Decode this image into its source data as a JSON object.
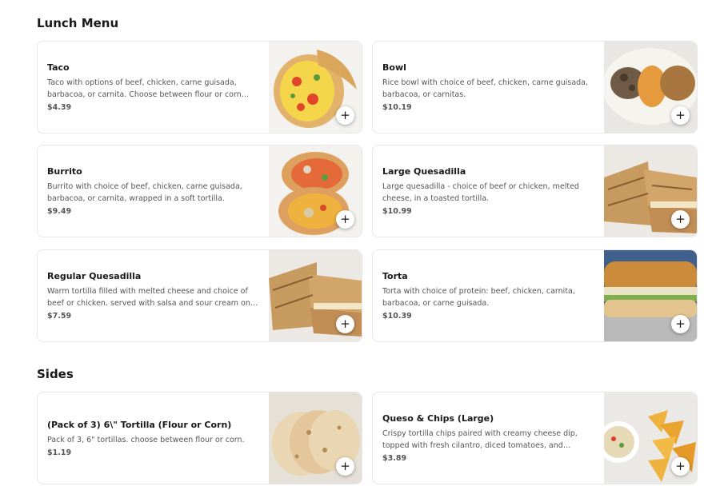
{
  "sections": [
    {
      "title": "Lunch Menu",
      "items": [
        {
          "name": "Taco",
          "description": "Taco with options of beef, chicken, carne guisada, barbacoa, or carnita. Choose between flour or corn tortilla.",
          "price": "$4.39",
          "image": "taco-image"
        },
        {
          "name": "Bowl",
          "description": "Rice bowl with choice of beef, chicken, carne guisada, barbacoa, or carnitas.",
          "price": "$10.19",
          "image": "bowl-image"
        },
        {
          "name": "Burrito",
          "description": "Burrito with choice of beef, chicken, carne guisada, barbacoa, or carnita, wrapped in a soft tortilla.",
          "price": "$9.49",
          "image": "burrito-image"
        },
        {
          "name": "Large Quesadilla",
          "description": "Large quesadilla - choice of beef or chicken, melted cheese, in a toasted tortilla.",
          "price": "$10.99",
          "image": "quesadilla-image"
        },
        {
          "name": "Regular Quesadilla",
          "description": "Warm tortilla filled with melted cheese and choice of beef or chicken. served with salsa and sour cream on the side.",
          "price": "$7.59",
          "image": "quesadilla-image"
        },
        {
          "name": "Torta",
          "description": "Torta with choice of protein: beef, chicken, carnita, barbacoa, or carne guisada.",
          "price": "$10.39",
          "image": "torta-image"
        }
      ]
    },
    {
      "title": "Sides",
      "items": [
        {
          "name": "(Pack of 3) 6\\\" Tortilla (Flour or Corn)",
          "description": "Pack of 3, 6\" tortillas. choose between flour or corn.",
          "price": "$1.19",
          "image": "tortillas-image"
        },
        {
          "name": "Queso & Chips (Large)",
          "description": "Crispy tortilla chips paired with creamy cheese dip, topped with fresh cilantro, diced tomatoes, and jalapeños.",
          "price": "$3.89",
          "image": "chips-image"
        }
      ]
    }
  ],
  "add_button_label": "+",
  "add_icon": "plus-icon",
  "colors": {
    "text": "#191919",
    "muted": "#555555",
    "border": "#e7e7e7"
  }
}
